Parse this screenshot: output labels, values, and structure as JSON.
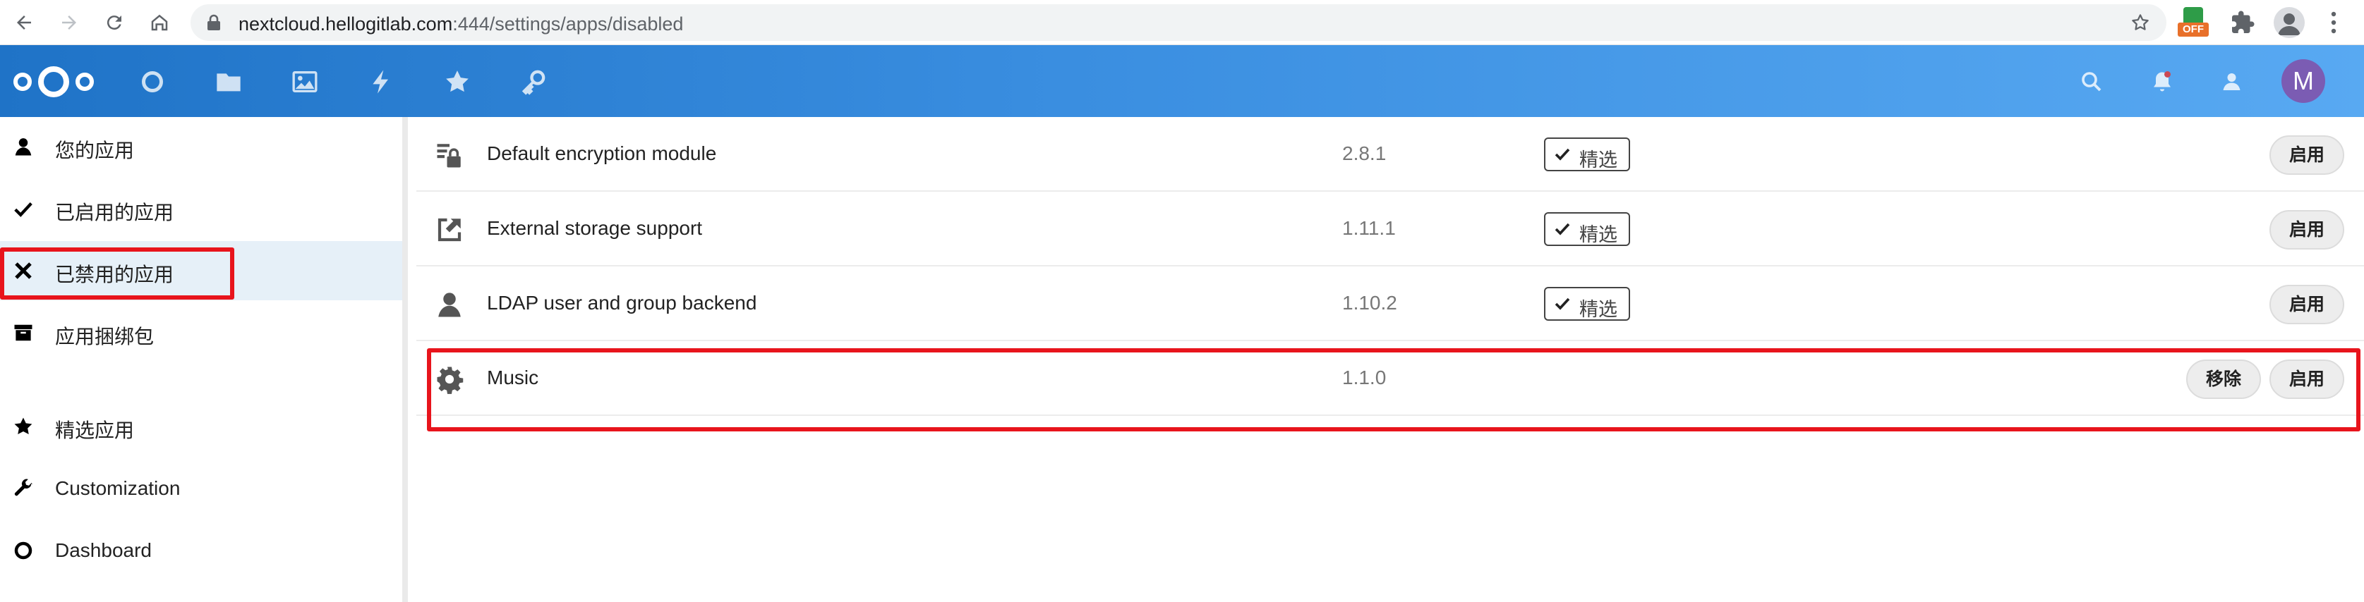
{
  "browser": {
    "url_host": "nextcloud.hellogitlab.com",
    "url_rest": ":444/settings/apps/disabled",
    "extension_badge": "OFF"
  },
  "header": {
    "avatar_letter": "M",
    "colors": {
      "gradient_start": "#1f73c7",
      "gradient_end": "#58a9f2",
      "avatar_bg": "#7b5cb3"
    }
  },
  "sidebar": {
    "items": [
      {
        "label": "您的应用",
        "icon": "user-icon"
      },
      {
        "label": "已启用的应用",
        "icon": "check-icon"
      },
      {
        "label": "已禁用的应用",
        "icon": "close-icon",
        "active": true
      },
      {
        "label": "应用捆绑包",
        "icon": "archive-icon"
      },
      {
        "label": "精选应用",
        "icon": "star-icon"
      },
      {
        "label": "Customization",
        "icon": "wrench-icon"
      },
      {
        "label": "Dashboard",
        "icon": "circle-icon"
      }
    ]
  },
  "apps": [
    {
      "name": "Default encryption module",
      "version": "2.8.1",
      "badge": "精选",
      "enable": "启用",
      "icon": "encryption-icon"
    },
    {
      "name": "External storage support",
      "version": "1.11.1",
      "badge": "精选",
      "enable": "启用",
      "icon": "external-link-icon"
    },
    {
      "name": "LDAP user and group backend",
      "version": "1.10.2",
      "badge": "精选",
      "enable": "启用",
      "icon": "user-icon"
    },
    {
      "name": "Music",
      "version": "1.1.0",
      "remove": "移除",
      "enable": "启用",
      "icon": "gear-icon"
    }
  ],
  "annotation_color": "#e8141c"
}
